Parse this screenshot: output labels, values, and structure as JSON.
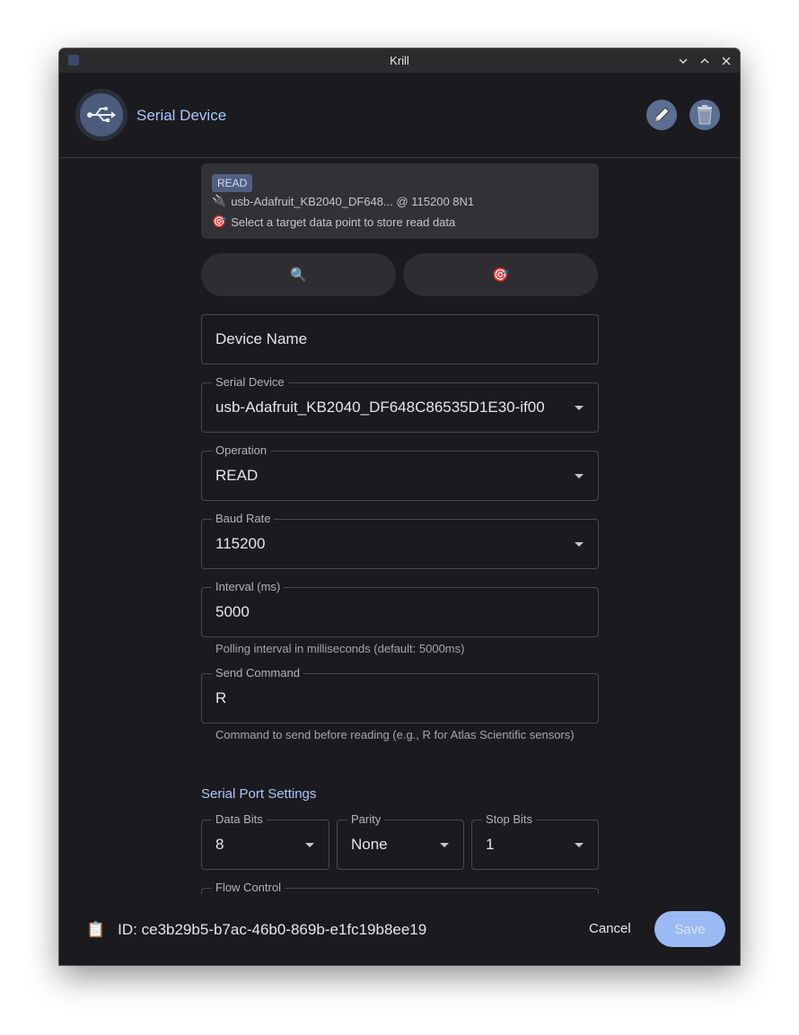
{
  "window": {
    "title": "Krill"
  },
  "header": {
    "title": "Serial Device"
  },
  "summary": {
    "chip": "READ",
    "line1_icon": "🔌",
    "line1": "usb-Adafruit_KB2040_DF648... @ 115200 8N1",
    "line2_icon": "🎯",
    "line2": "Select a target data point to store read data"
  },
  "actions": {
    "search_icon": "🔍",
    "target_icon": "🎯"
  },
  "fields": {
    "device_name": {
      "placeholder": "Device Name"
    },
    "serial_device": {
      "label": "Serial Device",
      "value": "usb-Adafruit_KB2040_DF648C86535D1E30-if00"
    },
    "operation": {
      "label": "Operation",
      "value": "READ"
    },
    "baud_rate": {
      "label": "Baud Rate",
      "value": "115200"
    },
    "interval": {
      "label": "Interval (ms)",
      "value": "5000",
      "helper": "Polling interval in milliseconds (default: 5000ms)"
    },
    "send_command": {
      "label": "Send Command",
      "value": "R",
      "helper": "Command to send before reading (e.g., R for Atlas Scientific sensors)"
    }
  },
  "serial_port_settings": {
    "title": "Serial Port Settings",
    "data_bits": {
      "label": "Data Bits",
      "value": "8"
    },
    "parity": {
      "label": "Parity",
      "value": "None"
    },
    "stop_bits": {
      "label": "Stop Bits",
      "value": "1"
    },
    "flow_control": {
      "label": "Flow Control"
    }
  },
  "footer": {
    "id_icon": "📋",
    "id_text": "ID: ce3b29b5-b7ac-46b0-869b-e1fc19b8ee19",
    "cancel": "Cancel",
    "save": "Save"
  }
}
